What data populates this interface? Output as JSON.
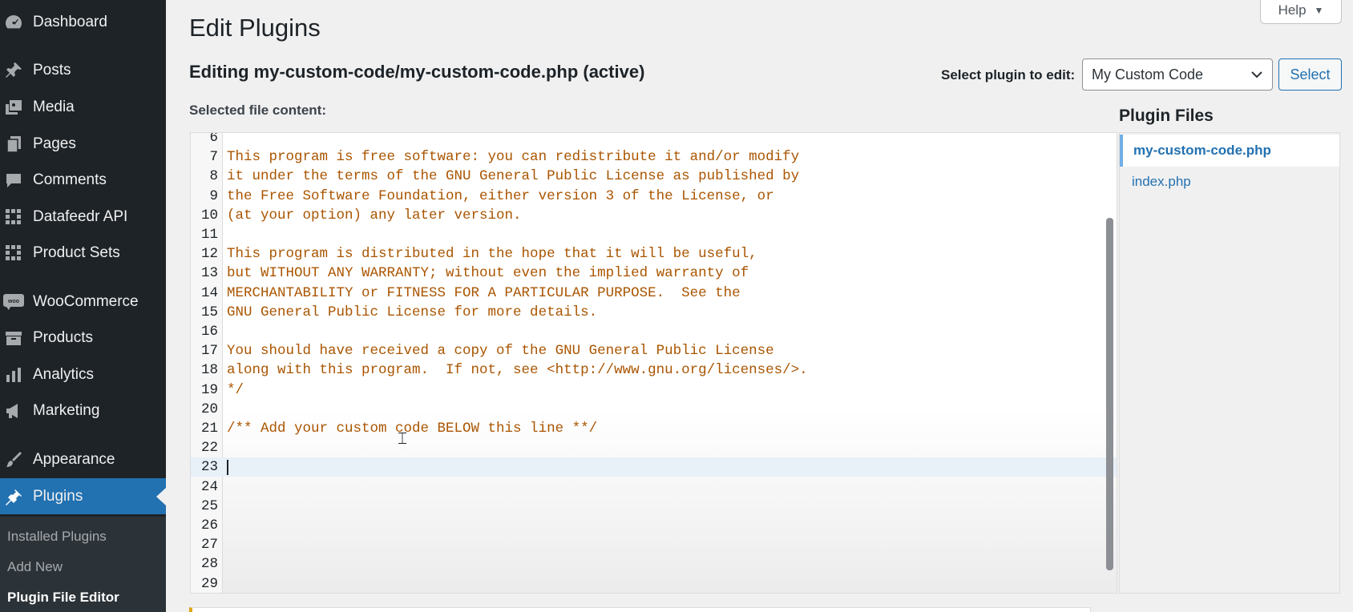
{
  "sidebar": {
    "items": [
      {
        "label": "Dashboard",
        "icon": "dashboard-icon"
      },
      {
        "label": "Posts",
        "icon": "pin-icon"
      },
      {
        "label": "Media",
        "icon": "media-icon"
      },
      {
        "label": "Pages",
        "icon": "pages-icon"
      },
      {
        "label": "Comments",
        "icon": "comment-icon"
      },
      {
        "label": "Datafeedr API",
        "icon": "grid-icon"
      },
      {
        "label": "Product Sets",
        "icon": "grid-icon"
      },
      {
        "label": "WooCommerce",
        "icon": "woo-icon"
      },
      {
        "label": "Products",
        "icon": "archive-icon"
      },
      {
        "label": "Analytics",
        "icon": "bar-chart-icon"
      },
      {
        "label": "Marketing",
        "icon": "megaphone-icon"
      },
      {
        "label": "Appearance",
        "icon": "paintbrush-icon"
      },
      {
        "label": "Plugins",
        "icon": "plug-icon"
      }
    ],
    "submenu": [
      "Installed Plugins",
      "Add New",
      "Plugin File Editor"
    ]
  },
  "header": {
    "title": "Edit Plugins",
    "help_label": "Help",
    "editing_title": "Editing my-custom-code/my-custom-code.php (active)",
    "select_label": "Select plugin to edit:",
    "selected_plugin": "My Custom Code",
    "select_button": "Select",
    "file_content_label": "Selected file content:"
  },
  "editor": {
    "lines": [
      {
        "n": "6",
        "text": ""
      },
      {
        "n": "7",
        "text": "This program is free software: you can redistribute it and/or modify"
      },
      {
        "n": "8",
        "text": "it under the terms of the GNU General Public License as published by"
      },
      {
        "n": "9",
        "text": "the Free Software Foundation, either version 3 of the License, or"
      },
      {
        "n": "10",
        "text": "(at your option) any later version."
      },
      {
        "n": "11",
        "text": ""
      },
      {
        "n": "12",
        "text": "This program is distributed in the hope that it will be useful,"
      },
      {
        "n": "13",
        "text": "but WITHOUT ANY WARRANTY; without even the implied warranty of"
      },
      {
        "n": "14",
        "text": "MERCHANTABILITY or FITNESS FOR A PARTICULAR PURPOSE.  See the"
      },
      {
        "n": "15",
        "text": "GNU General Public License for more details."
      },
      {
        "n": "16",
        "text": ""
      },
      {
        "n": "17",
        "text": "You should have received a copy of the GNU General Public License"
      },
      {
        "n": "18",
        "text": "along with this program.  If not, see <http://www.gnu.org/licenses/>."
      },
      {
        "n": "19",
        "text": "*/"
      },
      {
        "n": "20",
        "text": ""
      },
      {
        "n": "21",
        "text": "/** Add your custom code BELOW this line **/"
      },
      {
        "n": "22",
        "text": ""
      },
      {
        "n": "23",
        "text": ""
      },
      {
        "n": "24",
        "text": ""
      },
      {
        "n": "25",
        "text": ""
      },
      {
        "n": "26",
        "text": ""
      },
      {
        "n": "27",
        "text": ""
      },
      {
        "n": "28",
        "text": ""
      },
      {
        "n": "29",
        "text": ""
      }
    ],
    "cursor_line": "23"
  },
  "plugin_files": {
    "title": "Plugin Files",
    "files": [
      "my-custom-code.php",
      "index.php"
    ]
  }
}
